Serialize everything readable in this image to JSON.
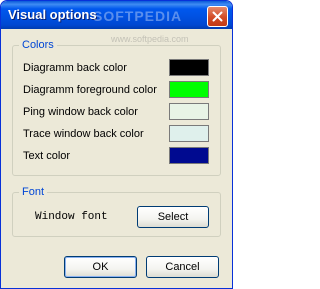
{
  "window": {
    "title": "Visual options",
    "watermark": "SOFTPEDIA",
    "watermark_sub": "www.softpedia.com"
  },
  "colors_group": {
    "label": "Colors",
    "items": [
      {
        "label": "Diagramm back color",
        "color": "#000000"
      },
      {
        "label": "Diagramm foreground color",
        "color": "#00ff00"
      },
      {
        "label": "Ping window back color",
        "color": "#e8f4e6"
      },
      {
        "label": "Trace window back color",
        "color": "#dff0ec"
      },
      {
        "label": "Text color",
        "color": "#000a90"
      }
    ]
  },
  "font_group": {
    "label": "Font",
    "sample": "Window font",
    "select_label": "Select"
  },
  "buttons": {
    "ok": "OK",
    "cancel": "Cancel"
  },
  "icons": {
    "close": "close-icon"
  }
}
